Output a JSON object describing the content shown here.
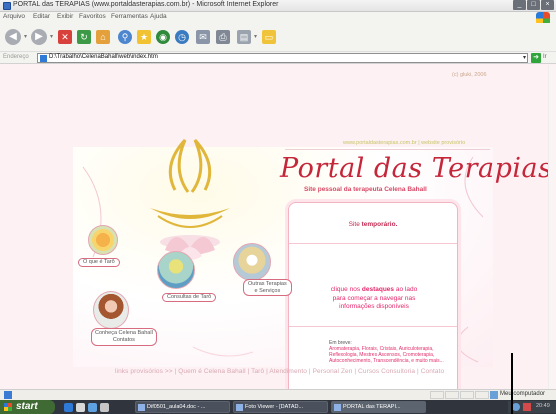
{
  "window": {
    "title": "PORTAL das TERAPIAS (www.portaldasterapias.com.br) - Microsoft Internet Explorer",
    "buttons": [
      "_",
      "□",
      "×"
    ]
  },
  "menu": [
    "Arquivo",
    "Editar",
    "Exibir",
    "Favoritos",
    "Ferramentas",
    "Ajuda"
  ],
  "toolbar": {
    "icons": [
      "back-icon",
      "forward-icon",
      "stop-icon",
      "refresh-icon",
      "home-icon",
      "search-icon",
      "favorites-icon",
      "media-icon",
      "history-icon",
      "mail-icon",
      "print-icon",
      "folder-icon"
    ],
    "back_glyph": "◀",
    "forward_glyph": "▶"
  },
  "address": {
    "label": "Endereço",
    "url": "D:\\Trabalho\\CelenaBahall\\web\\index.htm",
    "go_label": "Ir"
  },
  "site": {
    "copyright": "(c) gluki, 2006",
    "top_link": "www.portaldasterapias.com.br | website provisório",
    "title": "Portal das Terapias",
    "subtitle": "Site pessoal da terapeuta Celena Bahall",
    "temp_prefix": "Site",
    "temp_bold": "temporário.",
    "cta_line1_a": "clique nos",
    "cta_line1_b": "destaques",
    "cta_line1_c": "ao lado",
    "cta_line2": "para começar a navegar nas",
    "cta_line3": "informações disponíveis",
    "brief_label": "Em breve:",
    "brief_topics": "Aromaterapia, Florais, Cristais, Auriculoterapia, Reflexologia, Mestres Ascensos, Cromoterapia, Autoconhecimento, Transcendência, e muito mais...",
    "bubbles": {
      "taro": "O que é Tarô",
      "consultas": "Consultas de Tarô",
      "outras_1": "Outras Terapias",
      "outras_2": "e Serviços",
      "conheca_1": "Conheça Celena Bahall",
      "conheca_2": "Contatos"
    },
    "footer": "links provisórios >> | Quem é Celena Bahall | Tarô | Atendimento | Personal Zen | Cursos Consultoria | Contato"
  },
  "statusbar": {
    "zone": "Meu computador"
  },
  "taskbar": {
    "start": "start",
    "tasks": [
      "Dif0501_aula04.doc - ...",
      "Foto Viewer - [DATAD...",
      "PORTAL das TERAPI..."
    ],
    "clock": "20:49"
  },
  "colors": {
    "accent": "#c4263a",
    "pink": "#e6266a",
    "gold": "#e0b63b"
  }
}
